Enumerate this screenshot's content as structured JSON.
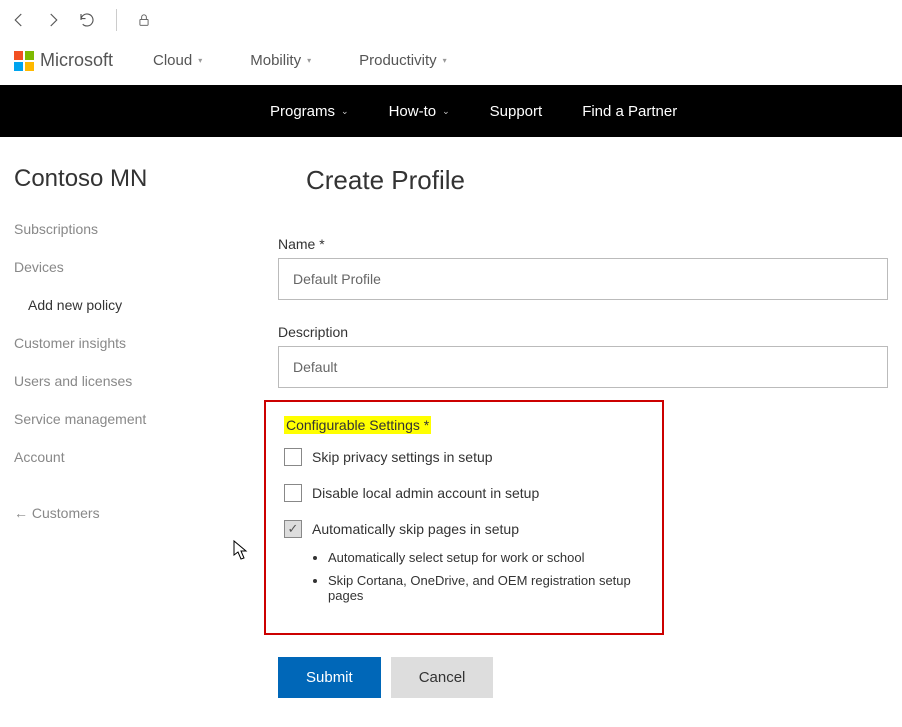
{
  "brand": {
    "name": "Microsoft"
  },
  "topnav": {
    "items": [
      "Cloud",
      "Mobility",
      "Productivity"
    ]
  },
  "blacknav": {
    "items": [
      "Programs",
      "How-to",
      "Support",
      "Find a Partner"
    ]
  },
  "sidebar": {
    "title": "Contoso MN",
    "links": {
      "subscriptions": "Subscriptions",
      "devices": "Devices",
      "add_new_policy": "Add new policy",
      "customer_insights": "Customer insights",
      "users_licenses": "Users and licenses",
      "service_management": "Service management",
      "account": "Account"
    },
    "back": "←  Customers"
  },
  "page": {
    "title": "Create Profile",
    "name_label": "Name *",
    "name_value": "Default Profile",
    "desc_label": "Description",
    "desc_value": "Default",
    "settings_header": "Configurable Settings *",
    "checks": {
      "skip_privacy": "Skip privacy settings in setup",
      "disable_admin": "Disable local admin account in setup",
      "auto_skip": "Automatically skip pages in setup"
    },
    "bullets": [
      "Automatically select setup for work or school",
      "Skip Cortana, OneDrive, and OEM registration setup pages"
    ],
    "submit": "Submit",
    "cancel": "Cancel"
  }
}
